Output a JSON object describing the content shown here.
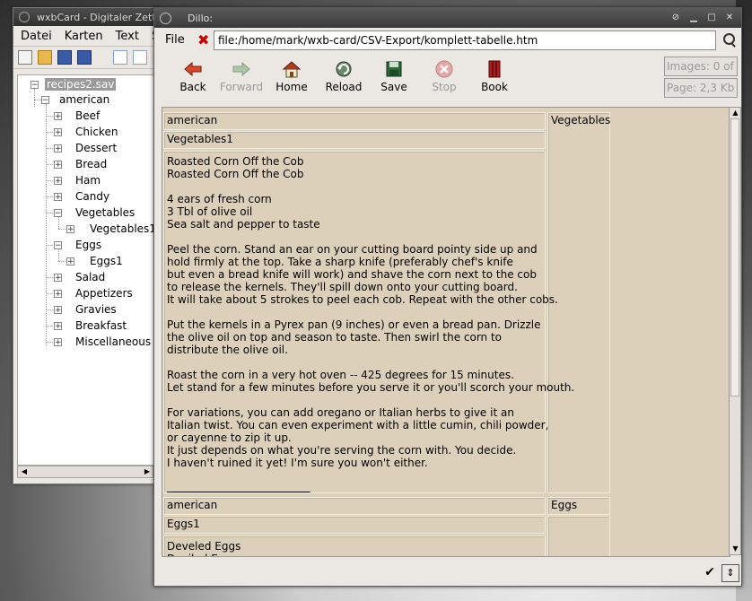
{
  "wxbcard": {
    "title": "wxbCard - Digitaler Zett",
    "menu": [
      "Datei",
      "Karten",
      "Text",
      "Sc"
    ],
    "toolbar_icons": [
      "new-file-icon",
      "open-folder-icon",
      "save-disk-icon",
      "save-as-icon",
      "window-icon",
      "print-icon"
    ],
    "tree": {
      "root": "recipes2.sav",
      "group": "american",
      "items": [
        "Beef",
        "Chicken",
        "Dessert",
        "Bread",
        "Ham",
        "Candy",
        "Vegetables",
        "Vegetables1",
        "Eggs",
        "Eggs1",
        "Salad",
        "Appetizers",
        "Gravies",
        "Breakfast",
        "Miscellaneous"
      ]
    }
  },
  "dillo": {
    "title": "Dillo:",
    "file_menu": "File",
    "url": "file:/home/mark/wxb-card/CSV-Export/komplett-tabelle.htm",
    "nav": {
      "back": "Back",
      "forward": "Forward",
      "home": "Home",
      "reload": "Reload",
      "save": "Save",
      "stop": "Stop",
      "book": "Book"
    },
    "info": {
      "images": "Images: 0 of 0",
      "page": "Page: 2,3 Kb"
    },
    "records": [
      {
        "group": "american",
        "category": "Vegetables",
        "name": "Vegetables1",
        "body": "Roasted Corn Off the Cob\nRoasted Corn Off the Cob\n\n4 ears of fresh corn\n3 Tbl of olive oil\nSea salt and pepper to taste\n\nPeel the corn. Stand an ear on your cutting board pointy side up and\nhold firmly at the top. Take a sharp knife (preferably chef's knife\nbut even a bread knife will work) and shave the corn next to the cob\nto release the kernels. They'll spill down onto your cutting board.\nIt will take about 5 strokes to peel each cob. Repeat with the other cobs.\n\nPut the kernels in a Pyrex pan (9 inches) or even a bread pan. Drizzle\nthe olive oil on top and season to taste. Then swirl the corn to\ndistribute the olive oil.\n\nRoast the corn in a very hot oven -- 425 degrees for 15 minutes.\nLet stand for a few minutes before you serve it or you'll scorch your mouth.\n\nFor variations, you can add oregano or Italian herbs to give it an\nItalian twist. You can even experiment with a little cumin, chili powder,\nor cayenne to zip it up.\nIt just depends on what you're serving the corn with. You decide.\nI haven't ruined it yet! I'm sure you won't either."
      },
      {
        "group": "american",
        "category": "Eggs",
        "name": "Eggs1",
        "body": "Develed Eggs\nDeviled Eggs"
      }
    ]
  }
}
